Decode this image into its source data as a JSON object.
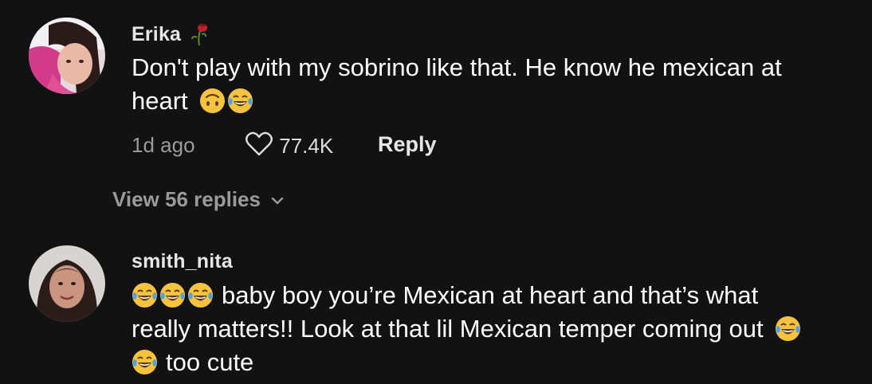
{
  "comments": [
    {
      "username": "Erika",
      "username_emoji": "wilted-rose-icon",
      "text_line1": "Don't play with my sobrino like that. He know he mexican at",
      "text_line2": "heart",
      "text_emojis": [
        "upside-down-face-icon",
        "tears-of-joy-icon"
      ],
      "time": "1d ago",
      "likes": "77.4K",
      "reply_label": "Reply",
      "view_replies": "View 56 replies"
    },
    {
      "username": "smith_nita",
      "text_line1": "baby boy you’re Mexican at heart and that’s what",
      "text_line2": "really matters!! Look at that lil Mexican temper coming out",
      "text_line3": "too cute",
      "text_emojis": [
        "tears-of-joy-icon"
      ]
    }
  ],
  "colors": {
    "background": "#121212",
    "primary_text": "#ffffff",
    "secondary_text": "#9a9a9a",
    "emoji_yellow": "#f7c23e"
  }
}
